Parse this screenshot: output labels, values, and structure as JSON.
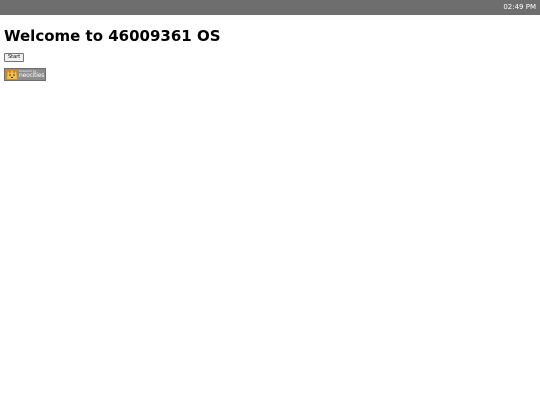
{
  "topbar": {
    "clock": "02:49 PM"
  },
  "main": {
    "title": "Welcome to 46009361 OS",
    "start_label": "Start"
  },
  "badge": {
    "small_text": "Powered by",
    "big_text": "neocities"
  },
  "colors": {
    "topbar": "#6e6e6e",
    "badge": "#8d8d8d"
  }
}
